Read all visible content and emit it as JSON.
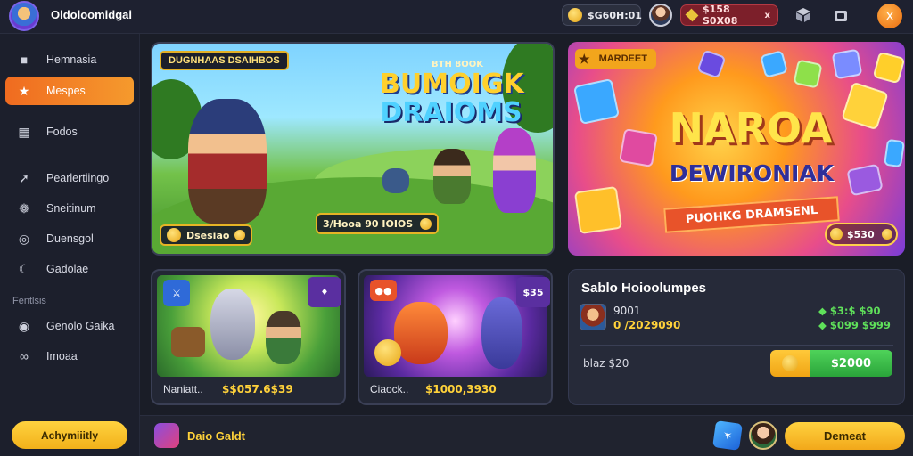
{
  "app": {
    "title": "Oldoloomidgai"
  },
  "topbar": {
    "coins": "$G60H:01",
    "gems": "$158 S0X08",
    "gems_close": "x",
    "icons": [
      "box-icon",
      "bag-icon"
    ],
    "orange_icon": "x"
  },
  "sidebar": {
    "items": [
      {
        "label": "Hemnasia",
        "icon": "controller-icon"
      },
      {
        "label": "Mespes",
        "icon": "star-icon"
      },
      {
        "label": "Fodos",
        "icon": "grid-icon"
      },
      {
        "label": "Pearlertiingo",
        "icon": "arrow-icon"
      },
      {
        "label": "Sneitinum",
        "icon": "leaf-icon"
      },
      {
        "label": "Duensgol",
        "icon": "globe-icon"
      },
      {
        "label": "Gadolae",
        "icon": "moon-icon"
      }
    ],
    "section_label": "Fentlsis",
    "section_items": [
      {
        "label": "Genolo Gaika",
        "icon": "circle-icon"
      },
      {
        "label": "Imoaa",
        "icon": "link-icon"
      }
    ],
    "cta": "Achymiiitly"
  },
  "hero": {
    "tag": "DUGNHAAS DSAIHBOS",
    "subtitle": "BTH 8OOK",
    "title_line1": "BUMOIGK",
    "title_line2": "DRAIOMS",
    "badge_left": "Dsesiao",
    "badge_right": "3/Hooa 90 IOIOS"
  },
  "promo": {
    "tag": "MARDEET",
    "title1": "NAROA",
    "title2": "DEWIRONIAK",
    "ribbon": "PUOHKG DRAMSENL",
    "badge": "$530"
  },
  "cards": [
    {
      "caption": "Naniatt..",
      "price": "$$057.6$39",
      "badge": ""
    },
    {
      "caption": "Ciaock..",
      "price": "$1000,3930",
      "badge": "$35"
    }
  ],
  "panel": {
    "title": "Sablo Hoioolumpes",
    "name": "9001",
    "amount": "0 /2029090",
    "green1": "$3:$ $90",
    "green2": "$099 $999",
    "label": "blaz $20",
    "button": "$2000"
  },
  "bottombar": {
    "label": "Daio Galdt",
    "button": "Demeat"
  },
  "colors": {
    "accent_orange": "#f06b20",
    "accent_yellow": "#ffd23f",
    "accent_green": "#2aa43a",
    "background": "#1a1d27"
  }
}
